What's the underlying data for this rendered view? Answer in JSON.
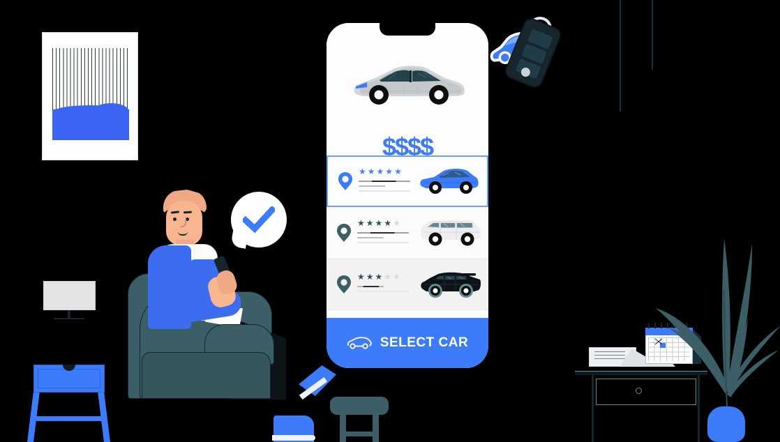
{
  "meta": {
    "scene_title": "Car rental mobile app illustration",
    "background_color": "#000000",
    "accent_blue": "#3c7bfa",
    "dark_teal": "#3c5e66"
  },
  "phone": {
    "hero": {
      "car_label": "sedan-car-illustration",
      "car_body_color": "#c9ccce",
      "car_window_color": "#24424b",
      "car_accent_color": "#3c7bfa"
    },
    "price": {
      "text": "$$$$",
      "symbol": "$",
      "count": 4,
      "color": "#3c7bfa"
    },
    "list": [
      {
        "id": "row-1",
        "selected": true,
        "pin_icon": "location-pin-icon",
        "pin_color": "#3c7bfa",
        "rating": 5,
        "rating_max": 5,
        "star_color": "#4f7ef7",
        "star_empty_color": "#d7dadd",
        "bars": [
          "long-dark",
          "short-gray",
          "long-faint"
        ],
        "car_label": "blue-hatchback",
        "car_color": "#3c7bfa",
        "row_background": "#fdfdfd"
      },
      {
        "id": "row-2",
        "selected": false,
        "pin_icon": "location-pin-icon",
        "pin_color": "#3c5e66",
        "rating": 4,
        "rating_max": 5,
        "star_color": "#2f4f5a",
        "star_empty_color": "#d7dadd",
        "bars": [
          "long-dark",
          "short-gray",
          "long-faint"
        ],
        "car_label": "white-minivan",
        "car_color": "#e9ebec",
        "row_background": "#fbfbfb"
      },
      {
        "id": "row-3",
        "selected": false,
        "pin_icon": "location-pin-icon",
        "pin_color": "#3c5e66",
        "rating": 3,
        "rating_max": 5,
        "star_color": "#2f4f5a",
        "star_empty_color": "#d7dadd",
        "bars": [
          "short-dark",
          "long-faint"
        ],
        "car_label": "black-suv",
        "car_color": "#0c1418",
        "row_background": "#f2f2f2"
      }
    ],
    "cta": {
      "label": "SELECT CAR",
      "icon": "car-outline-icon",
      "background": "#3c7bfa",
      "text_color": "#ffffff"
    }
  },
  "key_fob": {
    "label": "car-key-fob",
    "body_color": "#16262c",
    "ring_color": "#e6eaec",
    "buttons": [
      "lock-button",
      "unlock-button",
      "trunk-button"
    ],
    "keychain_label": "blue-car-keychain",
    "keychain_color": "#3c7bfa"
  },
  "person": {
    "label": "seated-man-with-phone",
    "jacket_color": "#3c6cf0",
    "shirt_color": "#fbfbfb",
    "skin_color": "#f7b68f",
    "shoe_color": "#3c7bfa",
    "speech_bubble": {
      "icon": "checkmark-icon",
      "check_color": "#3c7bfa",
      "bubble_color": "#ffffff"
    }
  },
  "room": {
    "wall_art": {
      "label": "abstract-wall-art",
      "frame_color": "#ffffff",
      "accent_color": "#3c64f4"
    },
    "tv": {
      "label": "tv-monitor",
      "screen_color": "#e2e3e4"
    },
    "side_table": {
      "label": "blue-side-table",
      "color": "#3c7bfa"
    },
    "armchair": {
      "label": "teal-armchair",
      "color": "#3c5e66"
    },
    "ottoman": {
      "label": "teal-ottoman",
      "color": "#3c5e66"
    },
    "desk": {
      "label": "wooden-desk",
      "color": "#16262c"
    },
    "calendar": {
      "label": "desk-calendar",
      "header_color": "#3c7bfa",
      "marked_day_color": "#3c7bfa"
    },
    "plant": {
      "label": "potted-palm-plant",
      "leaf_color": "#3c5e66",
      "pot_color": "#3c7bfa"
    }
  }
}
